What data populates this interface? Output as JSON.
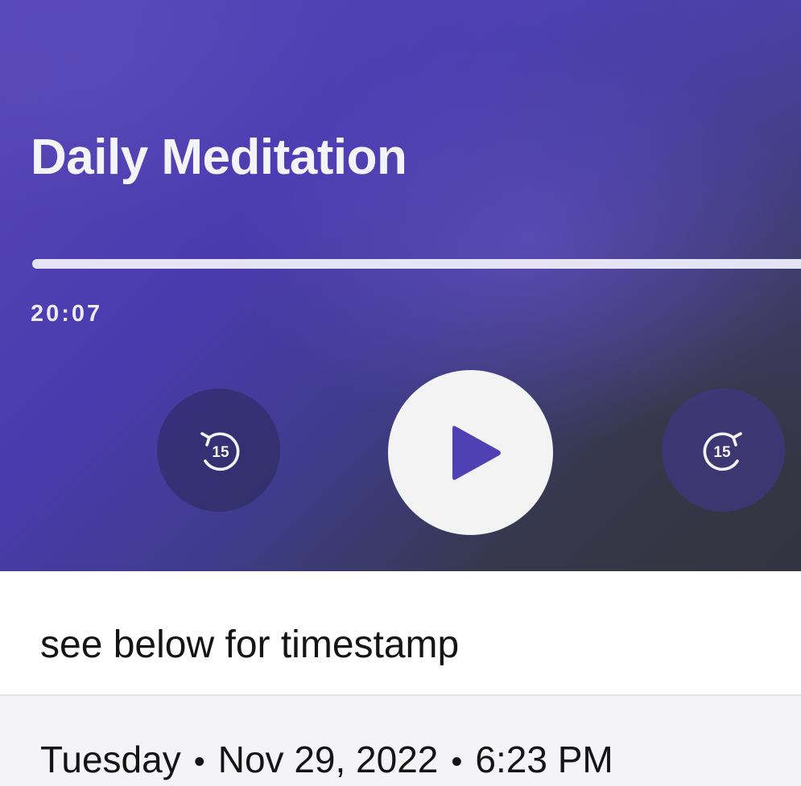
{
  "player": {
    "title": "Daily Meditation",
    "elapsed": "20:07",
    "progress": 1.0,
    "skip_back_seconds": "15",
    "skip_forward_seconds": "15",
    "play_icon": "play-icon",
    "colors": {
      "background_primary": "#4a3aae",
      "background_dark": "#33343f",
      "button_light": "#f3f3f4",
      "play_glyph": "#5140b4"
    }
  },
  "entry": {
    "description": "see below for timestamp",
    "day": "Tuesday",
    "date": "Nov 29, 2022",
    "time": "6:23 PM",
    "separator": "•"
  }
}
